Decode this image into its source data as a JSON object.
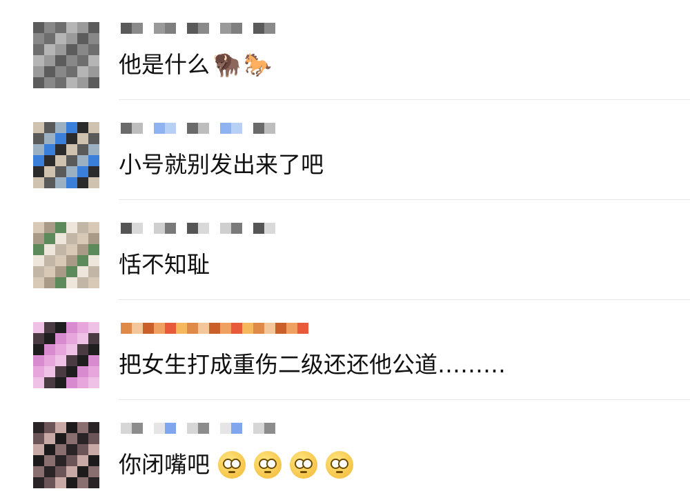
{
  "comments": [
    {
      "text": "他是什么",
      "emoji": [
        "🦬",
        "🐎"
      ],
      "emoji_names": [
        "bison-emoji",
        "horse-emoji"
      ],
      "avatar_colors": [
        "#5c5c5c",
        "#888888",
        "#6e6e6e",
        "#b5b5b5",
        "#9a9a9a",
        "#4a4a4a"
      ],
      "name_colors": [
        "#5a5a5a",
        "#8a8a8a",
        "#c8c8c8",
        "#9a9a9a",
        "#7f7f7f",
        "#6fa8f5"
      ]
    },
    {
      "text": "小号就别发出来了吧",
      "emoji": [],
      "emoji_names": [],
      "avatar_colors": [
        "#3a7fd9",
        "#2b2b2b",
        "#7c6b55",
        "#cfc3b0",
        "#5a5a5a",
        "#9bb0c0"
      ],
      "name_colors": [
        "#6a6a6a",
        "#bdbdbd",
        "#e0e0e0",
        "#8fb2f0",
        "#b8cff6",
        "#a7c4f3"
      ]
    },
    {
      "text": "恬不知耻",
      "emoji": [],
      "emoji_names": [],
      "avatar_colors": [
        "#d7c9b6",
        "#a89a86",
        "#5d8a5a",
        "#eee6da",
        "#c2b7a6",
        "#bdb3a3"
      ],
      "name_colors": [
        "#555555",
        "#d9d9d9",
        "#666666",
        "#cfcfcf",
        "#7a7a7a",
        "#e8e8e8"
      ]
    },
    {
      "text": "把女生打成重伤二级还还他公道………",
      "emoji": [],
      "emoji_names": [],
      "avatar_colors": [
        "#d98bd0",
        "#e7a6dc",
        "#2c2c2c",
        "#f0c1e6",
        "#4a3b42",
        "#1e1e1e"
      ],
      "name_colors": [
        "#e08a4a",
        "#f2c79a",
        "#c9602a",
        "#f0a060",
        "#e85a3a",
        "#f6b85c"
      ]
    },
    {
      "text": "你闭嘴吧",
      "emoji": [
        "face",
        "face",
        "face",
        "face"
      ],
      "emoji_names": [
        "face-with-rolling-eyes-emoji",
        "face-with-rolling-eyes-emoji",
        "face-with-rolling-eyes-emoji",
        "face-with-rolling-eyes-emoji"
      ],
      "avatar_colors": [
        "#2a2426",
        "#6b5558",
        "#c9a9a6",
        "#1d1a1b",
        "#8a6f70",
        "#e6d6d3"
      ],
      "name_colors": [
        "#d6d6d6",
        "#8c8c8c",
        "#c5c5c5",
        "#e5e5e5",
        "#7fa6ee",
        "#b8ccf3"
      ]
    }
  ]
}
